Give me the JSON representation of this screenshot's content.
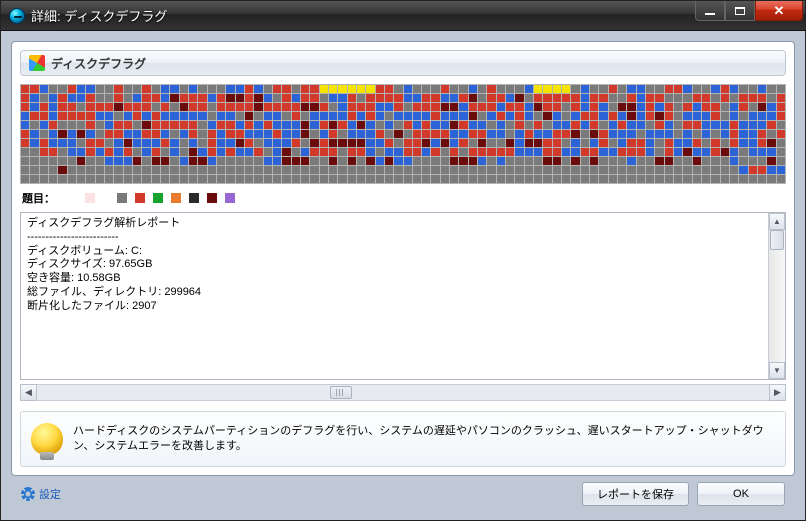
{
  "window": {
    "title": "詳細: ディスクデフラグ"
  },
  "section": {
    "header": "ディスクデフラグ"
  },
  "legend": {
    "label": "題目：",
    "colors": [
      "#fce1e1",
      "#7a7a7a",
      "#d13a2b",
      "#17a32e",
      "#e87b2f",
      "#2b2b2b",
      "#6b0c0c",
      "#9a67d2"
    ]
  },
  "report": {
    "title": "ディスクデフラグ解析レポート",
    "separator": "-------------------------",
    "lines": {
      "volume_label": "ディスクボリューム:",
      "volume_value": "C:",
      "size_label": "ディスクサイズ:",
      "size_value": "97.65GB",
      "free_label": "空き容量:",
      "free_value": "10.58GB",
      "files_label": "総ファイル、ディレクトリ:",
      "files_value": "299964",
      "frag_label": "断片化したファイル:",
      "frag_value": "2907"
    }
  },
  "info": {
    "text": "ハードディスクのシステムパーティションのデフラグを行い、システムの遅延やパソコンのクラッシュ、遅いスタートアップ・シャットダウン、システムエラーを改善します。"
  },
  "footer": {
    "settings": "設定",
    "save_report": "レポートを保存",
    "ok": "OK"
  },
  "defrag_map": {
    "rows": 11,
    "cols": 82,
    "pattern_seed": 12345,
    "note": "Block coloring approximates the fragmentation map shown in the screenshot; exact per-cell data is not recoverable.",
    "palette": {
      "gray": "#7a7a7a",
      "red": "#d13a2b",
      "blue": "#2c63d6",
      "darkred": "#6b0c0c",
      "yellow": "#f5e400"
    }
  }
}
